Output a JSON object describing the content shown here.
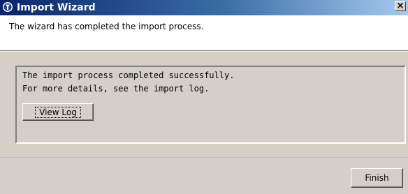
{
  "window": {
    "title": "Import Wizard",
    "icon": "wizard-app-icon",
    "close_label": "×"
  },
  "header": {
    "description": "The wizard has completed the import process."
  },
  "panel": {
    "line1": "The import process completed successfully.",
    "line2": "For more details, see the import log.",
    "view_log_label": "View Log"
  },
  "footer": {
    "finish_label": "Finish"
  },
  "colors": {
    "titlebar_start": "#0a246a",
    "titlebar_end": "#a6caf0",
    "face": "#d4d0c8"
  }
}
